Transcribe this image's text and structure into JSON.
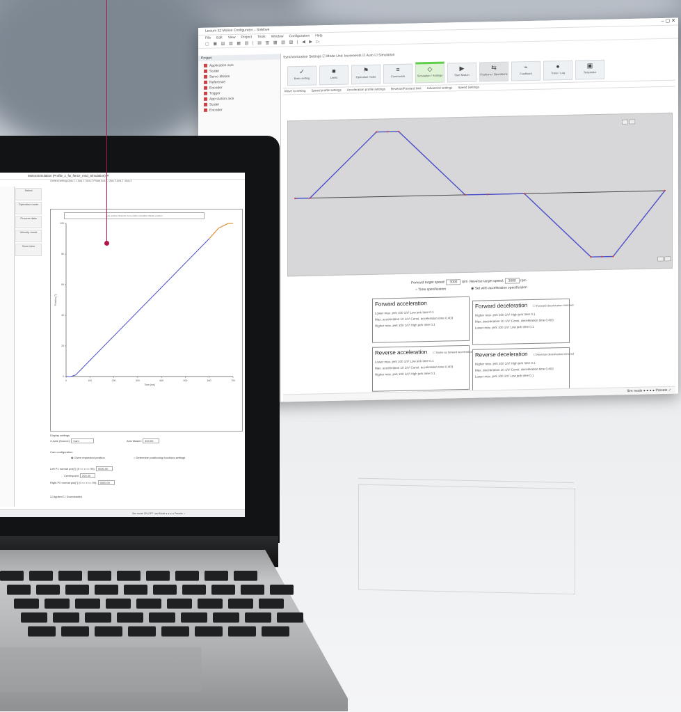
{
  "big_window": {
    "title": "Lexium 32 Motion Configurator – SoMove",
    "menu": [
      "File",
      "Edit",
      "View",
      "Project",
      "Tools",
      "Window",
      "Configuration",
      "Help"
    ],
    "toolbar_glyphs": "▢ ▣ ▤ ▥ ▦ ▧ | ▤ ▥ ▦ ▧ ▨ | ◀ ▶ ▷",
    "tree": {
      "header": "Project",
      "items": [
        "Application axis",
        "Scaler",
        "Servo Motion",
        "Reference",
        "Encoder",
        "Trigger",
        "App station axis",
        "Scaler",
        "Encoder"
      ]
    },
    "settings_bar": "Synchronization Settings   ☑ Mode   Unit: Increments   ☑ Auto   ☑ Simulation",
    "ribbon": [
      {
        "icon": "✓",
        "label": "Basic setting"
      },
      {
        "icon": "■",
        "label": "Limits"
      },
      {
        "icon": "⚑",
        "label": "Operation mode"
      },
      {
        "icon": "≡",
        "label": "Commands"
      },
      {
        "icon": "◇",
        "label": "Simulation / Settings"
      },
      {
        "icon": "▶",
        "label": "Start Motion"
      },
      {
        "icon": "⇆",
        "label": "Positions / Operations"
      },
      {
        "icon": "⌁",
        "label": "Feedback"
      },
      {
        "icon": "●",
        "label": "Trace / Log"
      },
      {
        "icon": "▣",
        "label": "Templates"
      }
    ],
    "tabs": [
      "Move to setting",
      "Speed profile settings",
      "Acceleration profile settings",
      "Reverse/Forward limit",
      "Advanced settings",
      "Speed Settings"
    ],
    "form": {
      "fwd_target": "Forward target speed:",
      "fwd_target_val": "3000",
      "rev_target": "Reverse target speed:",
      "rev_target_val": "3000",
      "unit": "rpm",
      "opt1": "Time specification",
      "opt2": "Set with acceleration specification"
    },
    "panels": [
      {
        "title": "Forward acceleration",
        "check": "",
        "rows": [
          "Lower max. jerk   100   1/s³  Low jerk time   0.1",
          "Max. acceleration  10   1/s²  Const. acceleration time  0.403",
          "Higher max. jerk   100   1/s³  High jerk time   0.1"
        ]
      },
      {
        "title": "Forward deceleration",
        "check": "☐ Forward deceleration mirrored",
        "rows": [
          "Higher max. jerk   100   1/s³  High jerk time   0.1",
          "Max. deceleration  10   1/s²  Const. deceleration time  0.403",
          "Lower max. jerk   100   1/s³  Low jerk time   0.1"
        ]
      },
      {
        "title": "Reverse acceleration",
        "check": "☐ Same as forward acceleration",
        "rows": [
          "Lower max. jerk   100   1/s³  Low jerk time   0.1",
          "Max. acceleration  10   1/s²  Const. acceleration time  0.403",
          "Higher max. jerk   100   1/s³  High jerk time   0.1"
        ]
      },
      {
        "title": "Reverse deceleration",
        "check": "☐ Reverse deceleration mirrored",
        "rows": [
          "Higher max. jerk   100   1/s³  High jerk time   0.1",
          "Max. deceleration  10   1/s²  Const. deceleration time  0.403",
          "Lower max. jerk   100   1/s³  Low jerk time   0.1"
        ]
      }
    ],
    "status_right": "Sim mode  ● ● ● ●   Presets ✓"
  },
  "laptop_window": {
    "title": "MotionSimulation (Profile_1_fw_fence_mod_Simulation) ✕",
    "tabs": "General settings   Axis 1 ×   Axis 1 / Axis 2 Phase   Axis 1 / Axis 3   Axis 2 / Axis 3",
    "side_buttons": [
      "Select",
      "Operation mode",
      "Process data",
      "Velocity mode",
      "Scan view"
    ],
    "legend": "Axis position   Setpoint   Cam position deviation   Master position",
    "plot_x_ticks": [
      "0",
      "100",
      "200",
      "300",
      "400",
      "500",
      "600",
      "700"
    ],
    "plot_y_ticks": [
      "100",
      "80",
      "60",
      "40",
      "20",
      "0"
    ],
    "plot_xlabel": "Time [ms]",
    "plot_ylabel": "Position [°]",
    "form": {
      "display_settings": "Display settings",
      "left_label": "X-Axis (Source):",
      "left_val": "Cam",
      "right_label": "Axis Master:",
      "right_val": "400.00",
      "cam_config": "Cam configuration",
      "opt_a": "◉ Given requested position",
      "opt_b": "○ Determine positioning functions settings",
      "row1_label": "Left P1 normal pos[°] (0 <= x <= 90):",
      "row1_val": "9000.00",
      "row2_label": "Centerpoint:",
      "row2_val": "200.00",
      "row3_label": "Right P2 normal pos[°] (0 <= x <= 90):",
      "row3_val": "9000.00",
      "apply": "☑ Applied   ☐ Downloaded"
    },
    "status": "Sim mode  ON-OFF     Last Mode  ● ● ● ●     Presets ✓"
  },
  "chart_data": [
    {
      "type": "line",
      "title": "",
      "xlabel": "Time [ms]",
      "ylabel": "Position [°]",
      "xlim": [
        0,
        700
      ],
      "ylim": [
        0,
        100
      ],
      "series": [
        {
          "values_x": [
            0,
            20,
            40,
            600,
            640,
            680,
            700
          ],
          "values": [
            0,
            0,
            1,
            90,
            97,
            100,
            100
          ]
        }
      ]
    },
    {
      "type": "line",
      "title": "",
      "xlabel": "",
      "ylabel": "",
      "xlim": [
        0,
        100
      ],
      "ylim": [
        -1,
        1
      ],
      "series": [
        {
          "values_x": [
            0,
            4,
            22,
            25,
            28,
            46,
            52,
            62,
            80,
            83,
            86,
            100
          ],
          "values": [
            0,
            0,
            1,
            1,
            1,
            0,
            0,
            0,
            -1,
            -1,
            -1,
            0
          ]
        }
      ]
    }
  ],
  "colors": {
    "accent_green": "#5fcf4a",
    "callout": "#b0124a",
    "plot_blue": "#4c50c8",
    "plot_orange": "#e79a34"
  }
}
